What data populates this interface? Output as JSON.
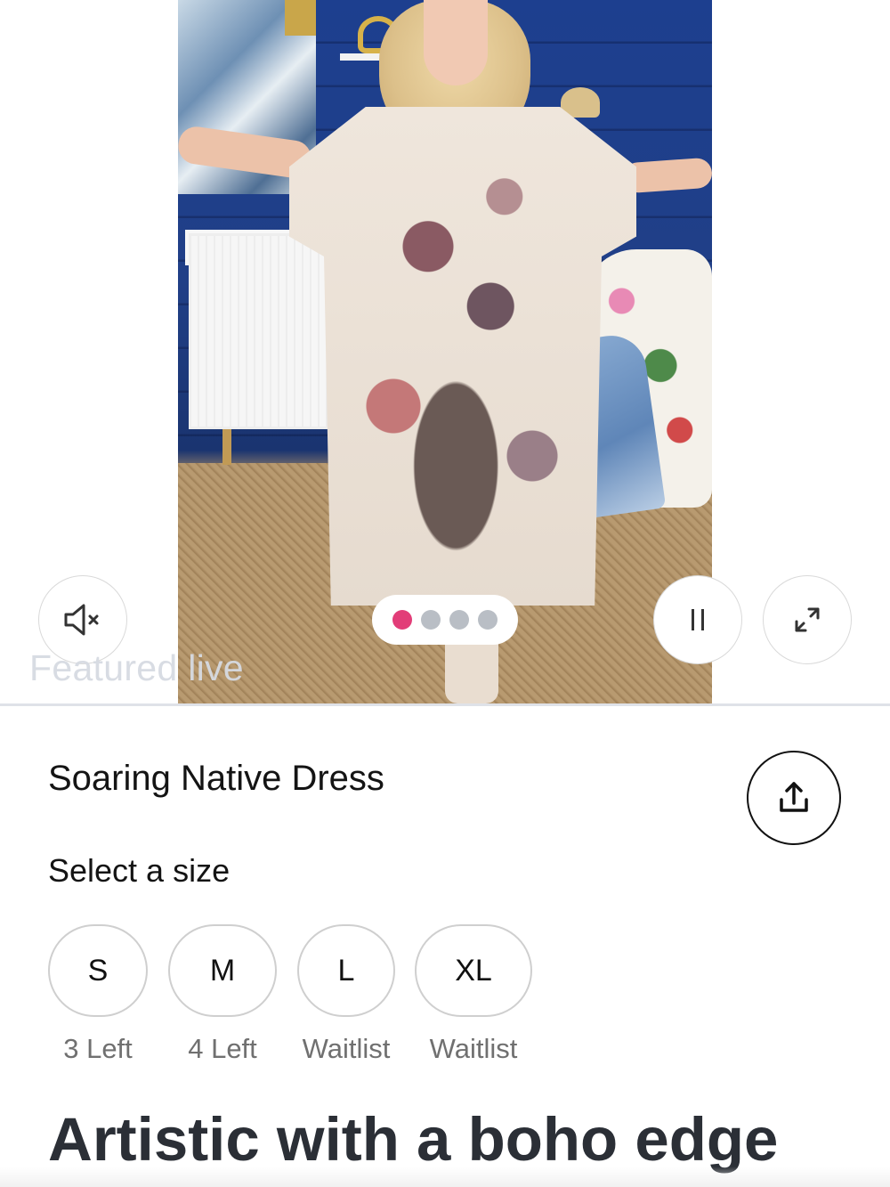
{
  "video": {
    "featured_label": "Featured live",
    "carousel_dots": [
      {
        "active": true
      },
      {
        "active": false
      },
      {
        "active": false
      },
      {
        "active": false
      }
    ],
    "controls": {
      "mute_icon": "speaker-muted-icon",
      "pause_icon": "pause-icon",
      "expand_icon": "expand-arrows-icon"
    }
  },
  "product": {
    "title": "Soaring Native Dress",
    "share_icon": "share-upload-icon",
    "size_heading": "Select a size",
    "sizes": [
      {
        "label": "S",
        "stock": "3 Left"
      },
      {
        "label": "M",
        "stock": "4 Left"
      },
      {
        "label": "L",
        "stock": "Waitlist"
      },
      {
        "label": "XL",
        "stock": "Waitlist"
      }
    ],
    "tagline": "Artistic with a boho edge"
  },
  "colors": {
    "active_dot": "#e23d78",
    "inactive_dot": "#b9bec5",
    "tagline": "#2b2f36"
  }
}
